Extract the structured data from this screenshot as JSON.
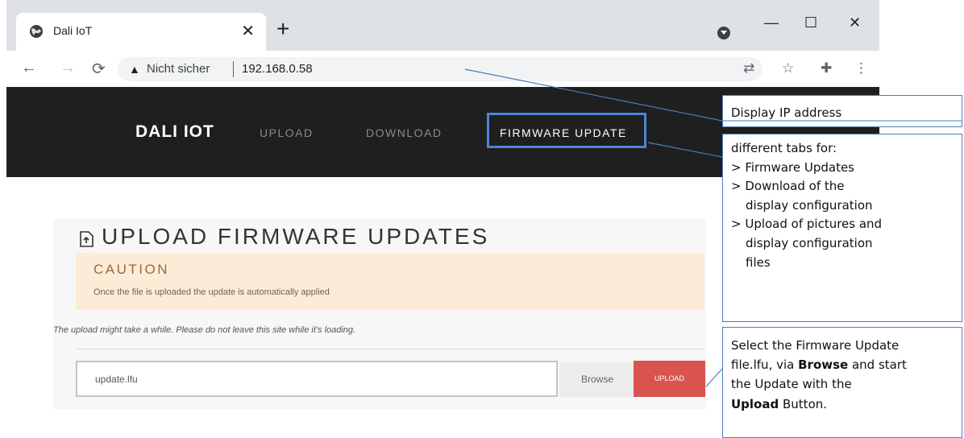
{
  "browser": {
    "tab_title": "Dali IoT",
    "tab_close": "✕",
    "new_tab": "+",
    "window": {
      "minimize": "—",
      "maximize": "☐",
      "close": "✕"
    },
    "security_label": "Nicht sicher",
    "url": "192.168.0.58"
  },
  "site_nav": {
    "brand": "DALI IOT",
    "links": [
      "UPLOAD",
      "DOWNLOAD",
      "FIRMWARE UPDATE"
    ],
    "active_link": "FIRMWARE UPDATE"
  },
  "page": {
    "title": "UPLOAD FIRMWARE UPDATES",
    "caution_heading": "CAUTION",
    "caution_text": "Once the file is uploaded the update is automatically applied",
    "note": "The upload might take a while. Please do not leave this site while it's loading.",
    "file_value": "update.lfu",
    "browse_label": "Browse",
    "upload_label": "UPLOAD"
  },
  "annotations": {
    "ip": "Display IP address",
    "tabs_intro": "different tabs for:",
    "tabs_1": "> Firmware Updates",
    "tabs_2a": "> Download of the",
    "tabs_2b": "display configuration",
    "tabs_3a": "> Upload of pictures and",
    "tabs_3b": "display configuration",
    "tabs_3c": "files",
    "upload_1": "Select the Firmware Update",
    "upload_2a": "file.lfu, via ",
    "upload_2b": "Browse",
    "upload_2c": " and start",
    "upload_3": "the Update with the",
    "upload_4a": "Upload",
    "upload_4b": " Button."
  },
  "colors": {
    "nav_bg": "#1f1f1f",
    "highlight": "#4a86d4",
    "caution_bg": "#fcebd7",
    "upload_btn": "#d9534f",
    "callout_border": "#4a7ebb"
  }
}
